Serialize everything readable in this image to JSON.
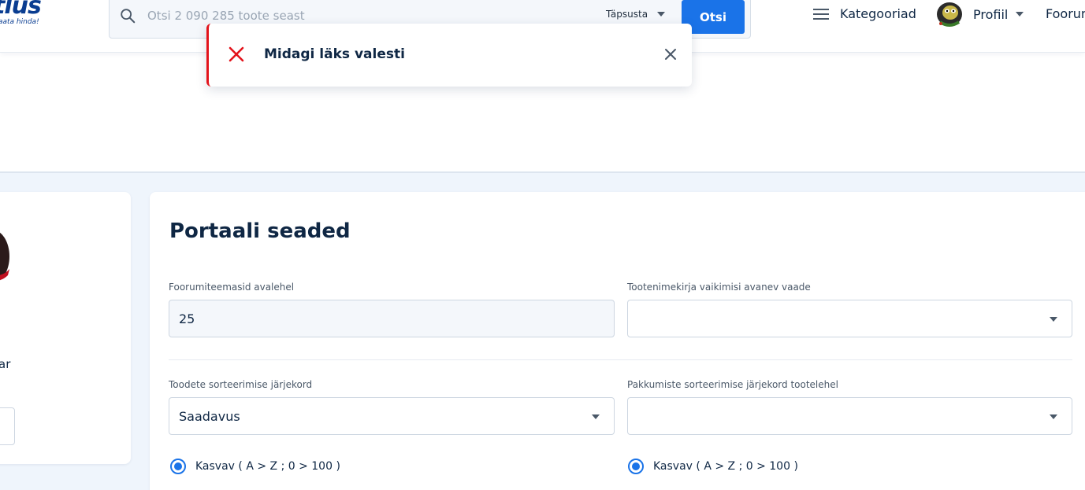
{
  "header": {
    "logo_text": "Hinnavaatlus",
    "logo_visible_text": "tlus",
    "logo_tagline": "aata hinda!",
    "search": {
      "placeholder": "Otsi 2 090 285 toote seast",
      "precise_label": "Täpsusta",
      "button_label": "Otsi"
    },
    "nav": {
      "categories_label": "Kategooriad",
      "profile_label": "Profiil",
      "forum_label": "Foorum"
    }
  },
  "toast": {
    "message": "Midagi läks valesti",
    "accent_color": "#e3131b"
  },
  "sidebar": {
    "partial_label": "ar"
  },
  "settings": {
    "title": "Portaali seaded",
    "forum_topics": {
      "label": "Foorumiteemasid avalehel",
      "value": "25"
    },
    "default_view": {
      "label": "Tootenimekirja vaikimisi avanev vaade",
      "value": ""
    },
    "product_sort": {
      "label": "Toodete sorteerimise järjekord",
      "value": "Saadavus"
    },
    "offer_sort": {
      "label": "Pakkumiste sorteerimise järjekord tootelehel",
      "value": ""
    },
    "product_sort_direction": {
      "label": "Kasvav ( A > Z ; 0 > 100 )",
      "selected": true
    },
    "offer_sort_direction": {
      "label": "Kasvav ( A > Z ; 0 > 100 )",
      "selected": true
    }
  },
  "colors": {
    "primary": "#1a73e8",
    "brand": "#0a3d91",
    "text": "#0f2744"
  }
}
